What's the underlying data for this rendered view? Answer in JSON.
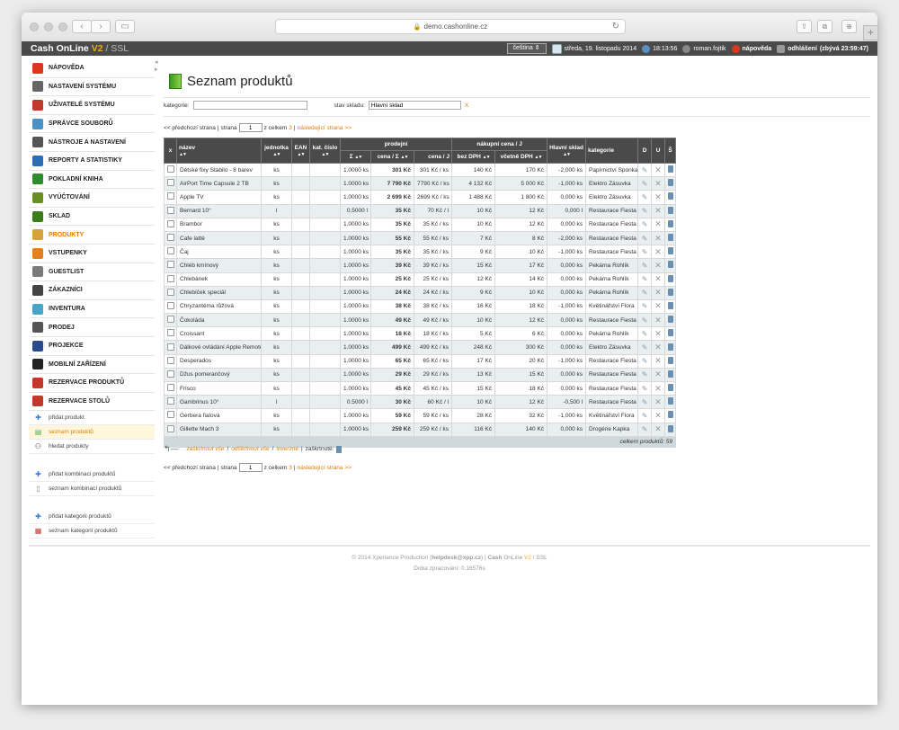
{
  "browser": {
    "url": "demo.cashonline.cz"
  },
  "app": {
    "brand_a": "Cash OnLine ",
    "brand_v": "V2",
    "brand_b": " / SSL",
    "lang": "čeština",
    "date": "středa, 19. listopadu 2014",
    "time": "18:13:56",
    "user": "roman.fojtik",
    "help": "nápověda",
    "logout": "odhlášení",
    "logout_remaining": "(zbývá 23:59:47)"
  },
  "sidebar": {
    "items": [
      {
        "label": "NÁPOVĚDA",
        "icon": "help-icon",
        "color": "#d9381e"
      },
      {
        "label": "NASTAVENÍ SYSTÉMU",
        "icon": "tools-icon",
        "color": "#666"
      },
      {
        "label": "UŽIVATELÉ SYSTÉMU",
        "icon": "users-icon",
        "color": "#c0392b"
      },
      {
        "label": "SPRÁVCE SOUBORŮ",
        "icon": "files-icon",
        "color": "#4a90c2"
      },
      {
        "label": "NÁSTROJE A NASTAVENÍ",
        "icon": "printer-icon",
        "color": "#555"
      },
      {
        "label": "REPORTY A STATISTIKY",
        "icon": "reports-icon",
        "color": "#2c6eb5"
      },
      {
        "label": "POKLADNÍ KNIHA",
        "icon": "cashbook-icon",
        "color": "#2e8b2e"
      },
      {
        "label": "VYÚČTOVÁNÍ",
        "icon": "billing-icon",
        "color": "#6b8e23"
      },
      {
        "label": "SKLAD",
        "icon": "warehouse-icon",
        "color": "#3a7d1a"
      },
      {
        "label": "PRODUKTY",
        "icon": "products-icon",
        "color": "#d4a23a"
      },
      {
        "label": "VSTUPENKY",
        "icon": "tickets-icon",
        "color": "#e67e22"
      },
      {
        "label": "GUESTLIST",
        "icon": "guestlist-icon",
        "color": "#7a7a7a"
      },
      {
        "label": "ZÁKAZNÍCI",
        "icon": "customers-icon",
        "color": "#444"
      },
      {
        "label": "INVENTURA",
        "icon": "inventory-icon",
        "color": "#4aa3c8"
      },
      {
        "label": "PRODEJ",
        "icon": "sale-icon",
        "color": "#555"
      },
      {
        "label": "PROJEKCE",
        "icon": "projection-icon",
        "color": "#2a4a8a"
      },
      {
        "label": "MOBILNÍ ZAŘÍZENÍ",
        "icon": "mobile-icon",
        "color": "#222"
      },
      {
        "label": "REZERVACE PRODUKTŮ",
        "icon": "calendar-icon",
        "color": "#c0392b"
      },
      {
        "label": "REZERVACE STOLŮ",
        "icon": "calendar-icon",
        "color": "#c0392b"
      }
    ],
    "active_index": 9,
    "sub1": [
      {
        "label": "přidat produkt",
        "icon": "plus-icon"
      },
      {
        "label": "seznam produktů",
        "icon": "list-icon"
      },
      {
        "label": "hledat produkty",
        "icon": "binoculars-icon"
      }
    ],
    "sub2": [
      {
        "label": "přidat kombinaci produktů",
        "icon": "plus-icon"
      },
      {
        "label": "seznam kombinací produktů",
        "icon": "doc-icon"
      }
    ],
    "sub3": [
      {
        "label": "přidat kategorii produktů",
        "icon": "plus-icon"
      },
      {
        "label": "seznam kategorií produktů",
        "icon": "grid-icon"
      }
    ]
  },
  "page": {
    "title": "Seznam produktů",
    "category_label": "kategorie:",
    "category_value": "",
    "stock_label": "stav skladu:",
    "stock_value": "Hlavní sklad",
    "clear": "X"
  },
  "pager": {
    "prev": "<< předchozí strana",
    "sep": "|",
    "page_label": "strana",
    "page_value": "1",
    "of_label": "z celkem",
    "total_pages": "3",
    "next": "následující strana >>"
  },
  "table": {
    "headers": {
      "x": "x",
      "name": "název",
      "unit": "jednotka",
      "ean": "EAN",
      "cat_no": "kat. číslo",
      "sale": "prodejní",
      "purchase": "nákupní cena / J",
      "stock": "Hlavní sklad",
      "category": "kategorie",
      "d": "D",
      "u": "U",
      "s": "Š",
      "sigma": "Σ",
      "sale_total": "cena / Σ",
      "sale_unit": "cena / J",
      "ex_vat": "bez DPH",
      "inc_vat": "včetně DPH"
    },
    "rows": [
      {
        "name": "Dětské fixy Stabilo - 8 barev",
        "unit": "ks",
        "qty": "1.0000 ks",
        "price": "301 Kč",
        "price_unit": "301 Kč / ks",
        "ex": "140 Kč",
        "inc": "170 Kč",
        "stock": "-2,000 ks",
        "category": "Papírnictví Sponka"
      },
      {
        "name": "AirPort Time Capsule 2 TB",
        "unit": "ks",
        "qty": "1.0000 ks",
        "price": "7 790 Kč",
        "price_unit": "7790 Kč / ks",
        "ex": "4 132 Kč",
        "inc": "5 000 Kč",
        "stock": "-1,000 ks",
        "category": "Elektro Zásuvka"
      },
      {
        "name": "Apple TV",
        "unit": "ks",
        "qty": "1.0000 ks",
        "price": "2 699 Kč",
        "price_unit": "2699 Kč / ks",
        "ex": "1 488 Kč",
        "inc": "1 800 Kč",
        "stock": "0,000 ks",
        "category": "Elektro Zásuvka"
      },
      {
        "name": "Bernard 10°",
        "unit": "l",
        "qty": "0.5000 l",
        "price": "35 Kč",
        "price_unit": "70 Kč / l",
        "ex": "10 Kč",
        "inc": "12 Kč",
        "stock": "0,000 l",
        "category": "Restaurace Fiesta"
      },
      {
        "name": "Brambor",
        "unit": "ks",
        "qty": "1.0000 ks",
        "price": "35 Kč",
        "price_unit": "35 Kč / ks",
        "ex": "10 Kč",
        "inc": "12 Kč",
        "stock": "0,000 ks",
        "category": "Restaurace Fiesta"
      },
      {
        "name": "Cafe latté",
        "unit": "ks",
        "qty": "1.0000 ks",
        "price": "55 Kč",
        "price_unit": "55 Kč / ks",
        "ex": "7 Kč",
        "inc": "8 Kč",
        "stock": "-2,000 ks",
        "category": "Restaurace Fiesta"
      },
      {
        "name": "Čaj",
        "unit": "ks",
        "qty": "1.0000 ks",
        "price": "35 Kč",
        "price_unit": "35 Kč / ks",
        "ex": "9 Kč",
        "inc": "10 Kč",
        "stock": "-1,000 ks",
        "category": "Restaurace Fiesta"
      },
      {
        "name": "Chléb kmínový",
        "unit": "ks",
        "qty": "1.0000 ks",
        "price": "39 Kč",
        "price_unit": "39 Kč / ks",
        "ex": "15 Kč",
        "inc": "17 Kč",
        "stock": "0,000 ks",
        "category": "Pekárna Rohlík"
      },
      {
        "name": "Chlebánek",
        "unit": "ks",
        "qty": "1.0000 ks",
        "price": "25 Kč",
        "price_unit": "25 Kč / ks",
        "ex": "12 Kč",
        "inc": "14 Kč",
        "stock": "0,000 ks",
        "category": "Pekárna Rohlík"
      },
      {
        "name": "Chlebíček speciál",
        "unit": "ks",
        "qty": "1.0000 ks",
        "price": "24 Kč",
        "price_unit": "24 Kč / ks",
        "ex": "9 Kč",
        "inc": "10 Kč",
        "stock": "0,000 ks",
        "category": "Pekárna Rohlík"
      },
      {
        "name": "Chryzantéma růžová",
        "unit": "ks",
        "qty": "1.0000 ks",
        "price": "38 Kč",
        "price_unit": "38 Kč / ks",
        "ex": "16 Kč",
        "inc": "18 Kč",
        "stock": "-1,000 ks",
        "category": "Květinářství Flora"
      },
      {
        "name": "Čokoláda",
        "unit": "ks",
        "qty": "1.0000 ks",
        "price": "49 Kč",
        "price_unit": "49 Kč / ks",
        "ex": "10 Kč",
        "inc": "12 Kč",
        "stock": "0,000 ks",
        "category": "Restaurace Fiesta"
      },
      {
        "name": "Croissant",
        "unit": "ks",
        "qty": "1.0000 ks",
        "price": "18 Kč",
        "price_unit": "18 Kč / ks",
        "ex": "5 Kč",
        "inc": "6 Kč",
        "stock": "0,000 ks",
        "category": "Pekárna Rohlík"
      },
      {
        "name": "Dálkové ovládání Apple Remote",
        "unit": "ks",
        "qty": "1.0000 ks",
        "price": "499 Kč",
        "price_unit": "499 Kč / ks",
        "ex": "248 Kč",
        "inc": "300 Kč",
        "stock": "0,000 ks",
        "category": "Elektro Zásuvka"
      },
      {
        "name": "Desperados",
        "unit": "ks",
        "qty": "1.0000 ks",
        "price": "65 Kč",
        "price_unit": "65 Kč / ks",
        "ex": "17 Kč",
        "inc": "20 Kč",
        "stock": "-1,000 ks",
        "category": "Restaurace Fiesta"
      },
      {
        "name": "Džus pomerančový",
        "unit": "ks",
        "qty": "1.0000 ks",
        "price": "29 Kč",
        "price_unit": "29 Kč / ks",
        "ex": "13 Kč",
        "inc": "15 Kč",
        "stock": "0,000 ks",
        "category": "Restaurace Fiesta"
      },
      {
        "name": "Frisco",
        "unit": "ks",
        "qty": "1.0000 ks",
        "price": "45 Kč",
        "price_unit": "45 Kč / ks",
        "ex": "15 Kč",
        "inc": "18 Kč",
        "stock": "0,000 ks",
        "category": "Restaurace Fiesta"
      },
      {
        "name": "Gambrinus 10°",
        "unit": "l",
        "qty": "0.5000 l",
        "price": "30 Kč",
        "price_unit": "60 Kč / l",
        "ex": "10 Kč",
        "inc": "12 Kč",
        "stock": "-0,500 l",
        "category": "Restaurace Fiesta"
      },
      {
        "name": "Gerbera fialová",
        "unit": "ks",
        "qty": "1.0000 ks",
        "price": "59 Kč",
        "price_unit": "59 Kč / ks",
        "ex": "28 Kč",
        "inc": "32 Kč",
        "stock": "-1,000 ks",
        "category": "Květinářství Flora"
      },
      {
        "name": "Gillette Mach 3",
        "unit": "ks",
        "qty": "1.0000 ks",
        "price": "259 Kč",
        "price_unit": "259 Kč / ks",
        "ex": "116 Kč",
        "inc": "140 Kč",
        "stock": "0,000 ks",
        "category": "Drogérie Kapka"
      }
    ],
    "total_label": "celkem produktů: 59"
  },
  "bulk": {
    "check_all": "zaškrtnout vše",
    "uncheck_all": "odškrtnout vše",
    "invert": "inverzně",
    "checked_label": "zaškrtnuté:"
  },
  "footer": {
    "line1_a": "© 2014 Xperience Production (",
    "line1_mail": "helpdesk@xpp.cz",
    "line1_b": ") | ",
    "line1_brand_a": "Cash",
    "line1_brand_b": " OnLine ",
    "line1_v": "V2",
    "line1_c": " / SSL",
    "line2": "Doba zpracování: 0.16576s"
  }
}
